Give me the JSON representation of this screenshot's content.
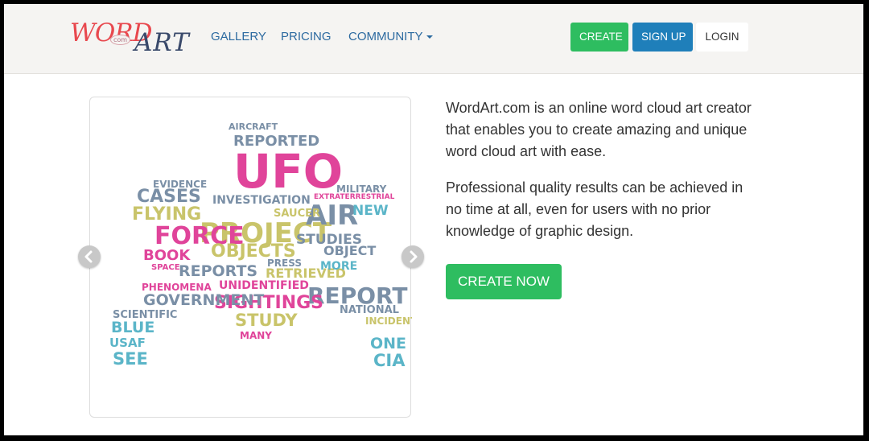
{
  "logo": {
    "part1": "WORD",
    "part2": "ART",
    "com": "com"
  },
  "nav": {
    "gallery": "GALLERY",
    "pricing": "PRICING",
    "community": "COMMUNITY"
  },
  "header_buttons": {
    "create": "CREATE",
    "signup": "SIGN UP",
    "login": "LOGIN"
  },
  "intro": {
    "p1": "WordArt.com is an online word cloud art creator that enables you to create amazing and unique word cloud art with ease.",
    "p2": "Professional quality results can be achieved in no time at all, even for users with no prior knowledge of graphic design."
  },
  "cta_label": "CREATE NOW",
  "colors": {
    "green": "#2ebd60",
    "blue": "#1f7fba",
    "link": "#2c6aa0",
    "pink": "#e0449a",
    "olive": "#c9c46a",
    "grayblue": "#7a8fa6",
    "teal": "#5bb5c8"
  },
  "carousel": {
    "words": [
      "UFO",
      "PROJECT",
      "FORCE",
      "FLYING",
      "CASES",
      "AIR",
      "OBJECTS",
      "BOOK",
      "REPORTS",
      "REPORT",
      "SIGHTINGS",
      "GOVERNMENT",
      "STUDIES",
      "STUDY",
      "REPORTED",
      "INVESTIGATION",
      "RETRIEVED",
      "UNIDENTIFIED",
      "PHENOMENA",
      "OBJECT",
      "NEW",
      "BLUE",
      "USAF",
      "SEE",
      "ONE",
      "CIA",
      "MILITARY",
      "AIRCRAFT",
      "SAUCER",
      "MORE",
      "SCIENTIFIC",
      "INCIDENT",
      "NATIONAL",
      "MANY",
      "PRESS",
      "EXTRATERRESTRIAL",
      "EVIDENCE",
      "SPACE"
    ],
    "prev_icon": "chevron-left-icon",
    "next_icon": "chevron-right-icon"
  }
}
